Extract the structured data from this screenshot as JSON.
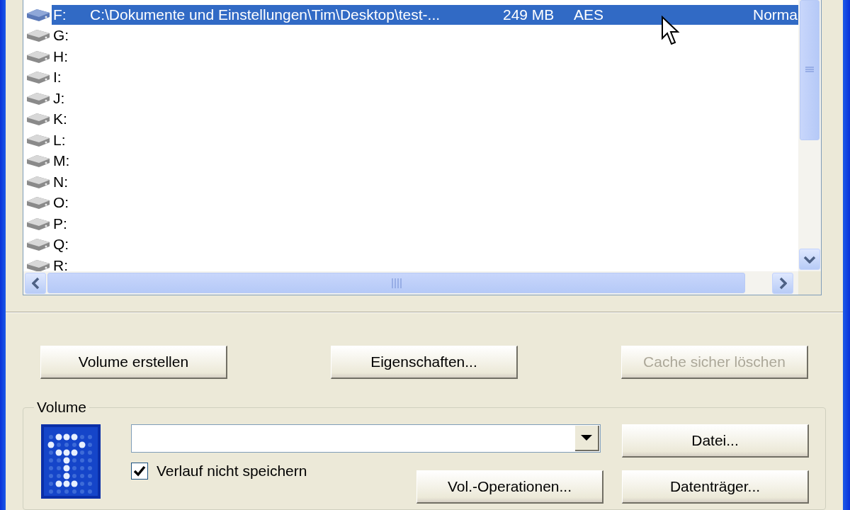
{
  "drives": [
    {
      "drive": "F:",
      "volume": "C:\\Dokumente und Einstellungen\\Tim\\Desktop\\test-...",
      "size": "249 MB",
      "algorithm": "AES",
      "type": "Norma",
      "selected": true
    },
    {
      "drive": "G:",
      "selected": false
    },
    {
      "drive": "H:",
      "selected": false
    },
    {
      "drive": "I:",
      "selected": false
    },
    {
      "drive": "J:",
      "selected": false
    },
    {
      "drive": "K:",
      "selected": false
    },
    {
      "drive": "L:",
      "selected": false
    },
    {
      "drive": "M:",
      "selected": false
    },
    {
      "drive": "N:",
      "selected": false
    },
    {
      "drive": "O:",
      "selected": false
    },
    {
      "drive": "P:",
      "selected": false
    },
    {
      "drive": "Q:",
      "selected": false
    },
    {
      "drive": "R:",
      "selected": false
    }
  ],
  "buttons": [
    {
      "label": "Volume erstellen",
      "disabled": false
    },
    {
      "label": "Eigenschaften...",
      "disabled": false
    },
    {
      "label": "Cache sicher löschen",
      "disabled": true
    }
  ],
  "volume_group": {
    "title": "Volume",
    "history_checkbox": {
      "label": "Verlauf nicht speichern",
      "checked": true
    },
    "file_button": "Datei...",
    "operations_button": "Vol.-Operationen...",
    "device_button": "Datenträger..."
  }
}
